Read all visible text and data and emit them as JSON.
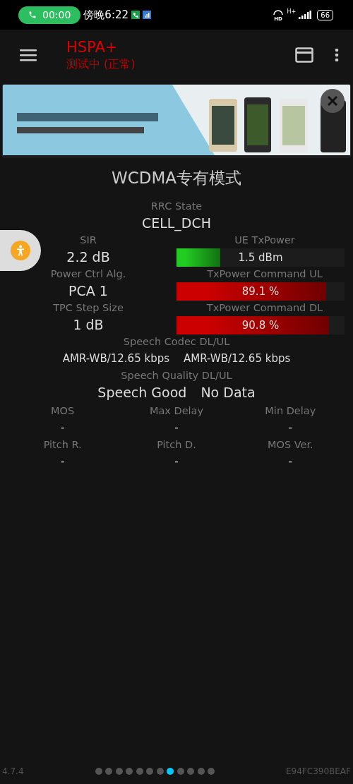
{
  "status_bar": {
    "call_time": "00:00",
    "clock": "傍晚6:22",
    "battery": "66",
    "network": "H+",
    "voice": "HD"
  },
  "toolbar": {
    "title": "HSPA+",
    "subtitle": "测试中 (正常)"
  },
  "mode_title": "WCDMA专有模式",
  "rrc": {
    "label": "RRC State",
    "value": "CELL_DCH"
  },
  "rows": [
    {
      "left": {
        "label": "SIR",
        "value": "2.2 dB"
      },
      "right": {
        "label": "UE TxPower",
        "reading": "1.5 dBm",
        "level": 0.26,
        "color": "#22cc22"
      }
    },
    {
      "left": {
        "label": "Power Ctrl Alg.",
        "value": "PCA 1"
      },
      "right": {
        "label": "TxPower Command UL",
        "reading": "89.1 %",
        "level": 0.891,
        "color": "#cc0000"
      }
    },
    {
      "left": {
        "label": "TPC Step Size",
        "value": "1 dB"
      },
      "right": {
        "label": "TxPower Command DL",
        "reading": "90.8 %",
        "level": 0.908,
        "color": "#cc0000"
      }
    }
  ],
  "codec": {
    "label": "Speech Codec DL/UL",
    "values": [
      "AMR-WB/12.65 kbps",
      "AMR-WB/12.65 kbps"
    ]
  },
  "quality": {
    "label": "Speech Quality DL/UL",
    "values": [
      "Speech Good",
      "No Data"
    ]
  },
  "grid": [
    {
      "label": "MOS",
      "value": "-"
    },
    {
      "label": "Max Delay",
      "value": "-"
    },
    {
      "label": "Min Delay",
      "value": "-"
    },
    {
      "label": "Pitch R.",
      "value": "-"
    },
    {
      "label": "Pitch D.",
      "value": "-"
    },
    {
      "label": "MOS Ver.",
      "value": "-"
    }
  ],
  "footer": {
    "version": "4.7.4",
    "device_id": "E94FC390BEAF",
    "pages": [
      {
        "selected": false
      },
      {
        "selected": false
      },
      {
        "selected": false
      },
      {
        "selected": false
      },
      {
        "selected": false
      },
      {
        "selected": false
      },
      {
        "selected": false
      },
      {
        "selected": true
      },
      {
        "selected": false
      },
      {
        "selected": false
      },
      {
        "selected": false
      },
      {
        "selected": false
      }
    ]
  }
}
